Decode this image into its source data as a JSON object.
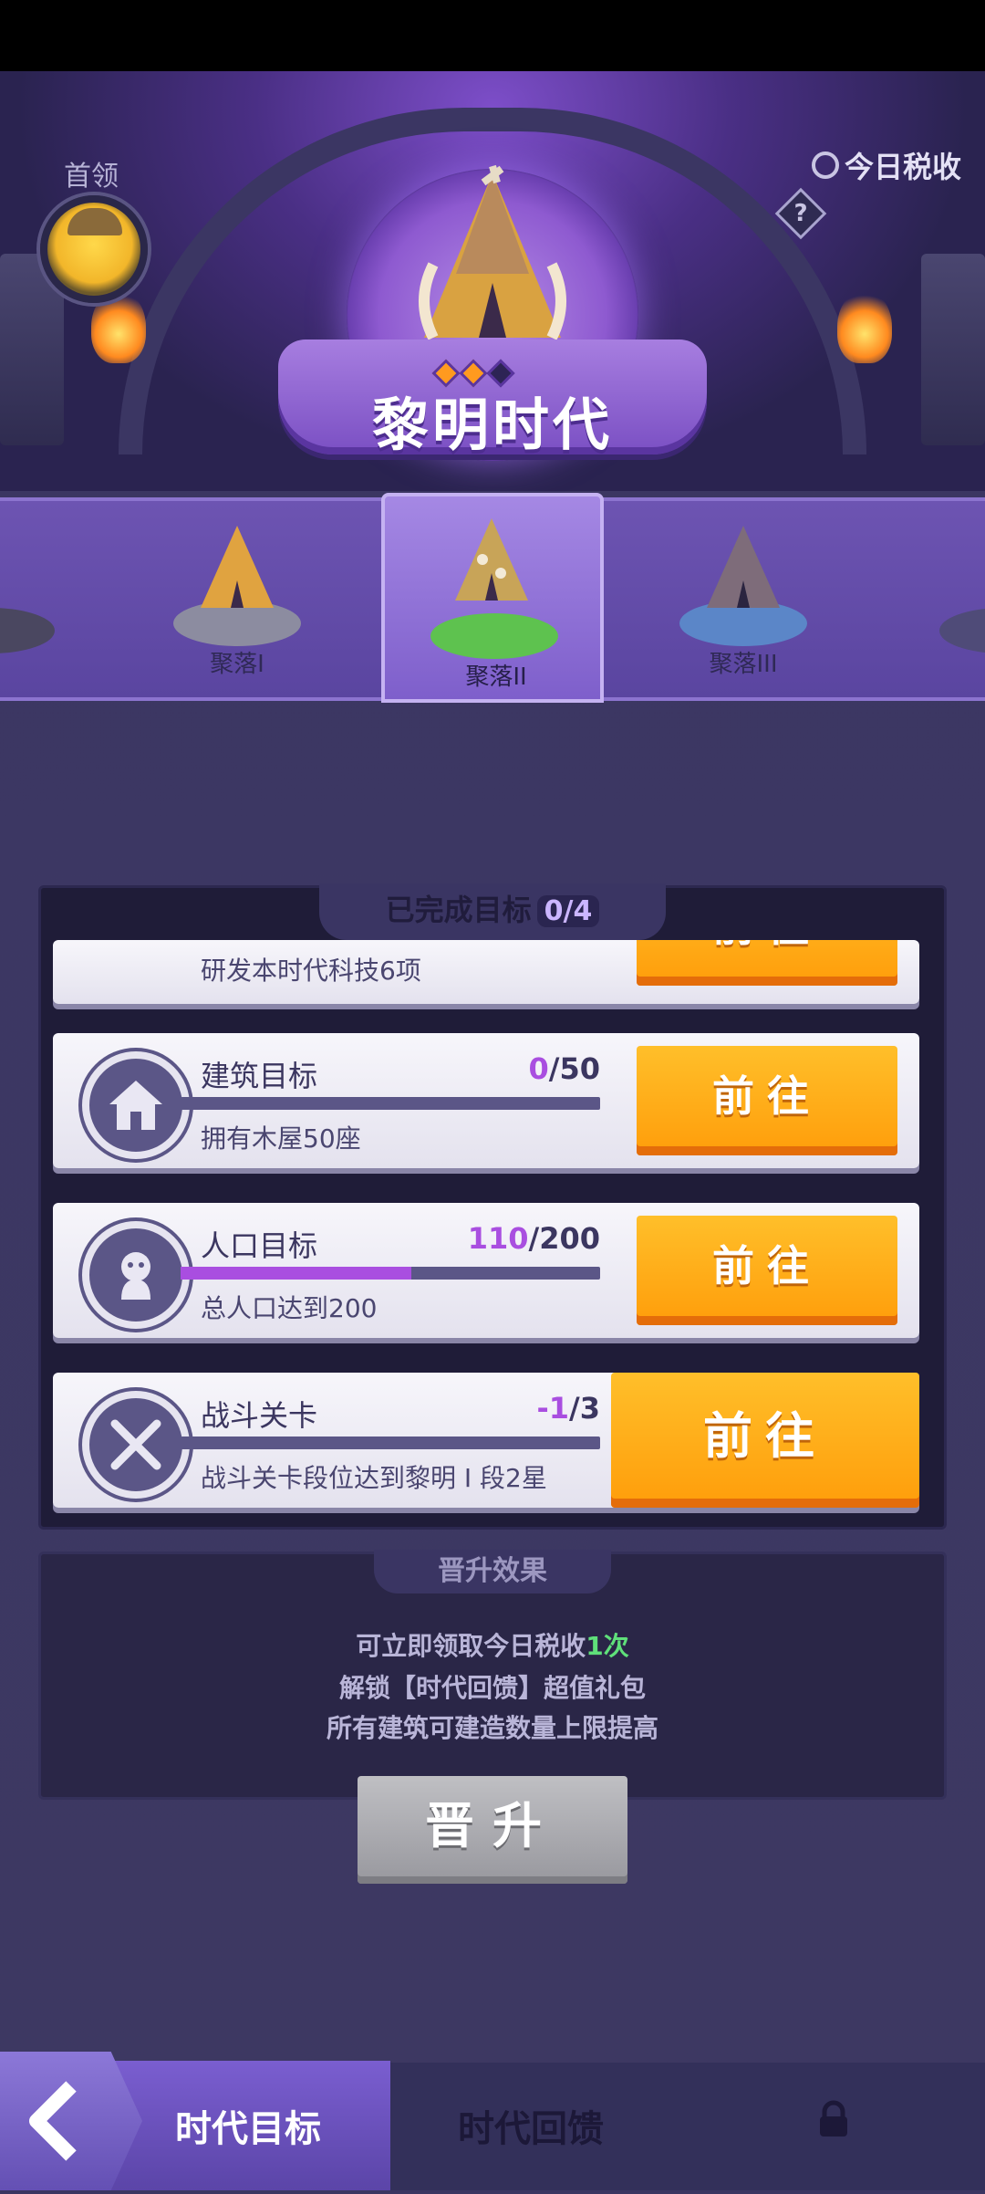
{
  "header": {
    "chief_label": "首领",
    "tax_label": "今日税收",
    "help_glyph": "?",
    "era_title": "黎明时代"
  },
  "stages": [
    {
      "label": "",
      "state": "previous"
    },
    {
      "label": "聚落I",
      "state": "done"
    },
    {
      "label": "聚落II",
      "state": "current"
    },
    {
      "label": "聚落III",
      "state": "locked"
    },
    {
      "label": "",
      "state": "next"
    }
  ],
  "goals": {
    "title": "已完成目标",
    "count": "0/4",
    "items": [
      {
        "name": "",
        "progress_current": "",
        "progress_total": "",
        "fill": 0,
        "desc": "研发本时代科技6项",
        "button": "前往",
        "icon": "book-icon"
      },
      {
        "name": "建筑目标",
        "progress_current": "0",
        "progress_total": "/50",
        "fill": 0,
        "desc": "拥有木屋50座",
        "button": "前往",
        "icon": "house-icon"
      },
      {
        "name": "人口目标",
        "progress_current": "110",
        "progress_total": "/200",
        "fill": 0.55,
        "desc": "总人口达到200",
        "button": "前往",
        "icon": "person-icon"
      },
      {
        "name": "战斗关卡",
        "progress_current": "-1",
        "progress_total": "/3",
        "fill": 0,
        "desc": "战斗关卡段位达到黎明 I 段2星",
        "button": "前往",
        "icon": "crossed-swords-icon"
      }
    ]
  },
  "effects": {
    "title": "晋升效果",
    "line1_prefix": "可立即领取今日税收",
    "line1_highlight": "1次",
    "line2": "解锁【时代回馈】超值礼包",
    "line3": "所有建筑可建造数量上限提高"
  },
  "promote_button": "晋升",
  "bottom_nav": {
    "tab1": "时代目标",
    "tab2": "时代回馈"
  },
  "colors": {
    "accent_orange": "#ffa715",
    "progress_purple": "#a94ee0",
    "highlight_green": "#5fe07a"
  }
}
